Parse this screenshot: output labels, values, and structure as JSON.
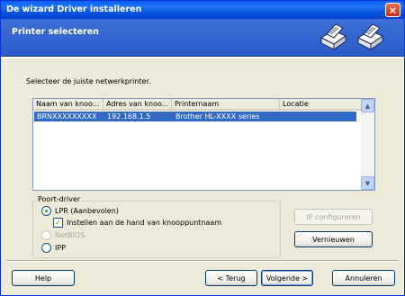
{
  "window": {
    "title": "De wizard Driver installeren",
    "close_symbol": "×"
  },
  "header": {
    "title": "Printer selecteren",
    "icons": [
      "printer-icon",
      "printer-icon"
    ]
  },
  "instruction": "Selecteer de juiste netwerkprinter.",
  "printer_list": {
    "columns": [
      "Naam van knoo...",
      "Adres van knoo...",
      "Printernaam",
      "Locatie"
    ],
    "rows": [
      {
        "node_name": "BRNXXXXXXXXX",
        "node_address": "192.168.1.5",
        "printer_name": "Brother HL-XXXX series",
        "location": "",
        "selected": true
      }
    ],
    "scroll_up": "▲",
    "scroll_down": "▼"
  },
  "port_driver": {
    "legend": "Poort-driver",
    "options": {
      "lpr": {
        "label": "LPR (Aanbevolen)",
        "selected": true,
        "enabled": true
      },
      "manual_node": {
        "label": "Instellen aan de hand van knooppuntnaam",
        "checked": true
      },
      "netbios": {
        "label": "NetBIOS",
        "selected": false,
        "enabled": false
      },
      "ipp": {
        "label": "IPP",
        "selected": false,
        "enabled": true
      }
    }
  },
  "buttons": {
    "ip_configure": "IP configureren",
    "refresh": "Vernieuwen",
    "help": "Help",
    "back": "< Terug",
    "next": "Volgende >",
    "cancel": "Annuleren"
  },
  "colors": {
    "title_bar": "#0a5ff0",
    "header": "#2b5bc8",
    "selection": "#316ac5",
    "dialog_bg": "#ece9d8"
  }
}
